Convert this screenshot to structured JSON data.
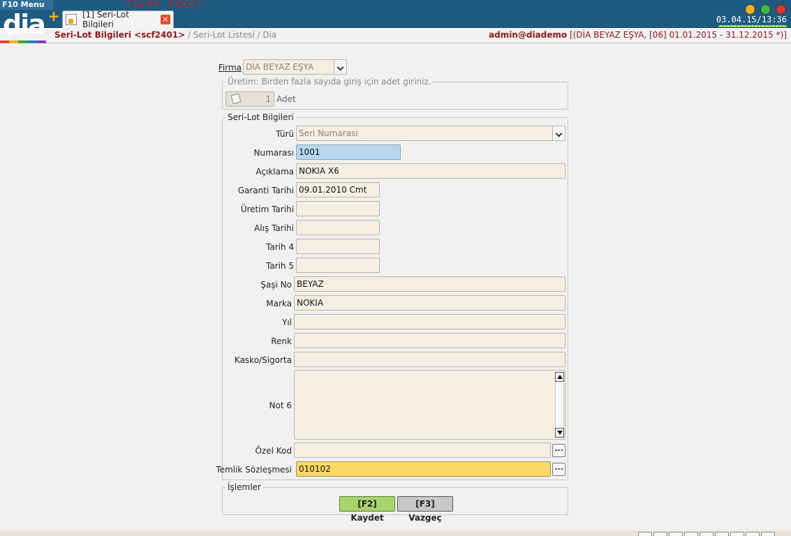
{
  "app": {
    "menu_label": "F10 Menu",
    "logo_text": "dia",
    "demo_label": "[DEMO MODU]",
    "logo_colors": [
      "#e94235",
      "#f3b023",
      "#3aaa35",
      "#2a7fc1",
      "#8a3ab0"
    ]
  },
  "tab": {
    "label": "[1] Seri-Lot Bilgileri",
    "close": "×"
  },
  "window_controls": {
    "colors": [
      "#f0b020",
      "#42b845",
      "#d63a2a"
    ]
  },
  "clock": "03.04.15/13:36",
  "breadcrumb": {
    "title": "Seri-Lot Bilgileri <scf2401>",
    "rest": " / Seri-Lot Listesi / Dia"
  },
  "user": {
    "name": "admin@diademo",
    "context": " [(DİA BEYAZ EŞYA, [06] 01.01.2015 - 31.12.2015 *)]"
  },
  "firma": {
    "label": "Firma",
    "value": "DİA BEYAZ EŞYA"
  },
  "uretim": {
    "legend": "Üretim: Birden fazla sayıda giriş için adet giriniz.",
    "value": "1",
    "unit": "Adet"
  },
  "serilot": {
    "legend": "Seri-Lot Bilgileri",
    "fields": {
      "turu": {
        "label": "Türü",
        "value": "Seri Numarası"
      },
      "numarasi": {
        "label": "Numarası",
        "value": "1001"
      },
      "aciklama": {
        "label": "Açıklama",
        "value": "NOKIA X6"
      },
      "garanti": {
        "label": "Garanti Tarihi",
        "value": "09.01.2010 Cmt"
      },
      "uretim_tarihi": {
        "label": "Üretim Tarihi",
        "value": ""
      },
      "alis_tarihi": {
        "label": "Alış Tarihi",
        "value": ""
      },
      "tarih4": {
        "label": "Tarih 4",
        "value": ""
      },
      "tarih5": {
        "label": "Tarih 5",
        "value": ""
      },
      "sasi_no": {
        "label": "Şaşi No",
        "value": "BEYAZ"
      },
      "marka": {
        "label": "Marka",
        "value": "NOKIA"
      },
      "yil": {
        "label": "Yıl",
        "value": ""
      },
      "renk": {
        "label": "Renk",
        "value": ""
      },
      "kasko": {
        "label": "Kasko/Sigorta",
        "value": ""
      },
      "not6": {
        "label": "Not 6",
        "value": ""
      },
      "ozel_kod": {
        "label": "Özel Kod",
        "value": ""
      },
      "temlik": {
        "label": "Temlik Sözleşmesi",
        "value": "010102"
      }
    },
    "ellipsis": "..."
  },
  "islemler": {
    "legend": "İşlemler",
    "save": "[F2] Kaydet",
    "cancel": "[F3] Vazgeç"
  }
}
